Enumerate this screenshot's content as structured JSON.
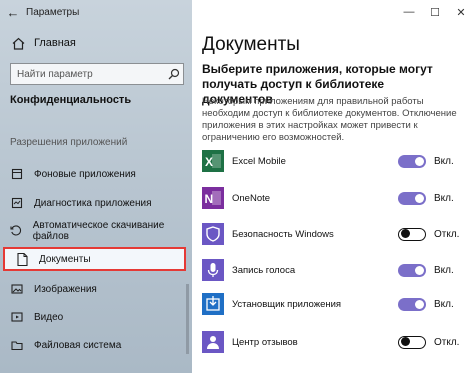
{
  "window": {
    "title": "Параметры"
  },
  "sidebar": {
    "back_icon": "back-arrow-icon",
    "home_label": "Главная",
    "search_placeholder": "Найти параметр",
    "section_title": "Конфиденциальность",
    "group_label": "Разрешения приложений",
    "items": [
      {
        "label": "Фоновые приложения",
        "icon": "background-apps-icon"
      },
      {
        "label": "Диагностика приложения",
        "icon": "diagnostics-icon"
      },
      {
        "label": "Автоматическое скачивание файлов",
        "icon": "auto-download-icon"
      },
      {
        "label": "Документы",
        "icon": "document-icon",
        "active": true
      },
      {
        "label": "Изображения",
        "icon": "pictures-icon"
      },
      {
        "label": "Видео",
        "icon": "video-icon"
      },
      {
        "label": "Файловая система",
        "icon": "file-system-icon"
      }
    ]
  },
  "main": {
    "title": "Документы",
    "heading": "Выберите приложения, которые могут получать доступ к библиотеке документов",
    "description": "Некоторым приложениям для правильной работы необходим доступ к библиотеке документов. Отключение приложения в этих настройках может привести к ограничению его возможностей.",
    "apps": [
      {
        "name": "Excel Mobile",
        "state": "Вкл.",
        "on": true,
        "icon": "excel-icon",
        "color": "#1e7145"
      },
      {
        "name": "OneNote",
        "state": "Вкл.",
        "on": true,
        "icon": "onenote-icon",
        "color": "#7b2e9e"
      },
      {
        "name": "Безопасность Windows",
        "state": "Откл.",
        "on": false,
        "icon": "shield-icon",
        "color": "#6b57c4"
      },
      {
        "name": "Запись голоса",
        "state": "Вкл.",
        "on": true,
        "icon": "microphone-icon",
        "color": "#6b57c4"
      },
      {
        "name": "Установщик приложения",
        "state": "Вкл.",
        "on": true,
        "icon": "installer-icon",
        "color": "#1f6fc5"
      },
      {
        "name": "Центр отзывов",
        "state": "Откл.",
        "on": false,
        "icon": "feedback-icon",
        "color": "#6b57c4"
      }
    ]
  },
  "colors": {
    "accent": "#7b6fc9",
    "highlight_border": "#e53935"
  }
}
